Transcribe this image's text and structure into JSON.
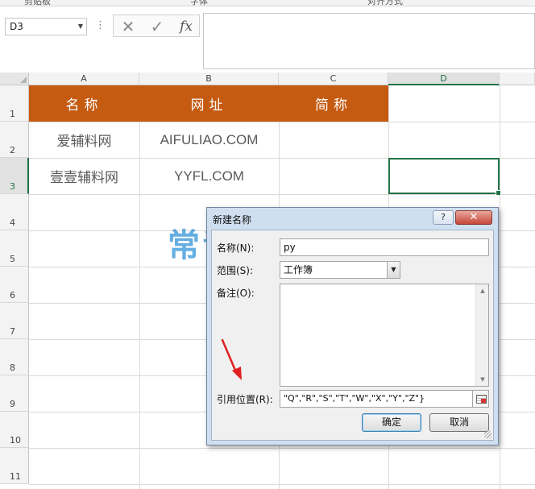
{
  "ribbon": {
    "groups": [
      "剪贴板",
      "字体",
      "对齐方式"
    ]
  },
  "formula_bar": {
    "name_box": "D3",
    "cancel_icon": "✕",
    "enter_icon": "✓",
    "function_icon": "fx",
    "content": ""
  },
  "sheet": {
    "columns": [
      "A",
      "B",
      "C",
      "D"
    ],
    "active_column": "D",
    "rows": [
      "1",
      "2",
      "3",
      "4",
      "5",
      "6",
      "7",
      "8",
      "9",
      "10",
      "11"
    ],
    "active_row": "3",
    "header_row": [
      "名称",
      "网址",
      "简称"
    ],
    "data_rows": [
      [
        "爱辅料网",
        "AIFULIAO.COM",
        ""
      ],
      [
        "壹壹辅料网",
        "YYFL.COM",
        ""
      ]
    ],
    "selected_cell": "D3",
    "header_fill_color": "#C55A11"
  },
  "watermark": "常青藤网子",
  "dialog": {
    "title": "新建名称",
    "help_label": "?",
    "close_label": "✕",
    "name_label": "名称(N):",
    "name_value": "py",
    "scope_label": "范围(S):",
    "scope_value": "工作簿",
    "comment_label": "备注(O):",
    "comment_value": "",
    "refers_to_label": "引用位置(R):",
    "refers_to_value": "\"Q\",\"R\",\"S\",\"T\",\"W\",\"X\",\"Y\",\"Z\"}",
    "ok_label": "确定",
    "cancel_label": "取消"
  }
}
